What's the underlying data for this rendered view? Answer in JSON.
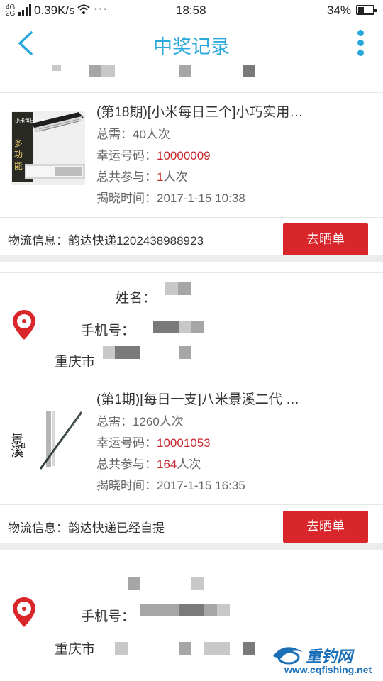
{
  "status_bar": {
    "network": "4G",
    "network_sub": "2G",
    "speed": "0.39K/s",
    "more": "···",
    "time": "18:58",
    "battery": "34%"
  },
  "nav": {
    "title": "中奖记录",
    "back_icon": "chevron-left-icon",
    "menu_icon": "more-vertical-icon"
  },
  "colors": {
    "accent": "#29a8dc",
    "red_value": "#c8282d",
    "button": "#d8262b"
  },
  "records": [
    {
      "title": "(第18期)[小米每日三个]小巧实用…",
      "need_label": "总需：",
      "need_value": "40人次",
      "lucky_label": "幸运号码：",
      "lucky_value": "10000009",
      "join_label": "总共参与：",
      "join_count": "1",
      "join_unit": "人次",
      "time_label": "揭晓时间：",
      "time_value": "2017-1-15 10:38",
      "logistics": "物流信息：韵达快递1202438988923",
      "button": "去晒单"
    },
    {
      "title": "(第1期)[每日一支]八米景溪二代 …",
      "need_label": "总需：",
      "need_value": "1260人次",
      "lucky_label": "幸运号码：",
      "lucky_value": "10001053",
      "join_label": "总共参与：",
      "join_count": "164",
      "join_unit": "人次",
      "time_label": "揭晓时间：",
      "time_value": "2017-1-15 16:35",
      "logistics": "物流信息：韵达快递已经自提",
      "button": "去晒单"
    }
  ],
  "address_1": {
    "name_label": "姓名：",
    "phone_label": "手机号：",
    "address_start": "重庆市"
  },
  "address_2": {
    "phone_label": "手机号：",
    "address_start": "重庆市"
  },
  "product_images": [
    {
      "text": "小米每日三个"
    },
    {
      "text": "景溪"
    }
  ],
  "watermark": {
    "brand": "重钓网",
    "url": "www.cqfishing.net"
  }
}
